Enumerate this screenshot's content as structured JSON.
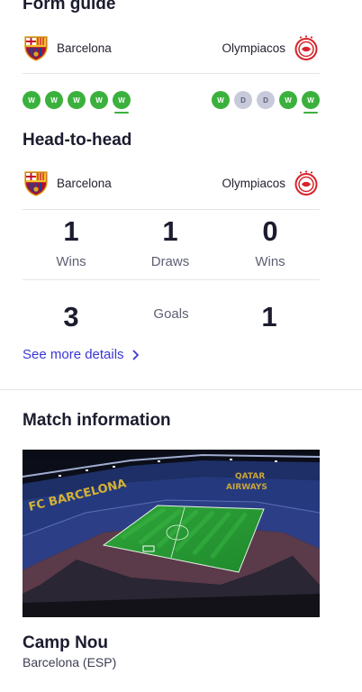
{
  "form_guide": {
    "title": "Form guide",
    "home_team": "Barcelona",
    "away_team": "Olympiacos",
    "home_form": [
      "W",
      "W",
      "W",
      "W",
      "W"
    ],
    "away_form": [
      "W",
      "D",
      "D",
      "W",
      "W"
    ]
  },
  "head_to_head": {
    "title": "Head-to-head",
    "home_team": "Barcelona",
    "away_team": "Olympiacos",
    "home_wins": "1",
    "home_wins_label": "Wins",
    "draws": "1",
    "draws_label": "Draws",
    "away_wins": "0",
    "away_wins_label": "Wins",
    "home_goals": "3",
    "goals_label": "Goals",
    "away_goals": "1",
    "see_more": "See more details"
  },
  "match_info": {
    "title": "Match information",
    "venue_name": "Camp Nou",
    "venue_location": "Barcelona (ESP)",
    "stand_text_1": "FC BARCELONA",
    "stand_text_2": "QATAR",
    "stand_text_3": "AIRWAYS"
  },
  "colors": {
    "win": "#3bb13d",
    "draw": "#c8cadb",
    "link": "#3a37d6"
  },
  "icons": {
    "home_crest": "barcelona-crest-icon",
    "away_crest": "olympiacos-crest-icon",
    "chevron": "chevron-right-icon"
  }
}
